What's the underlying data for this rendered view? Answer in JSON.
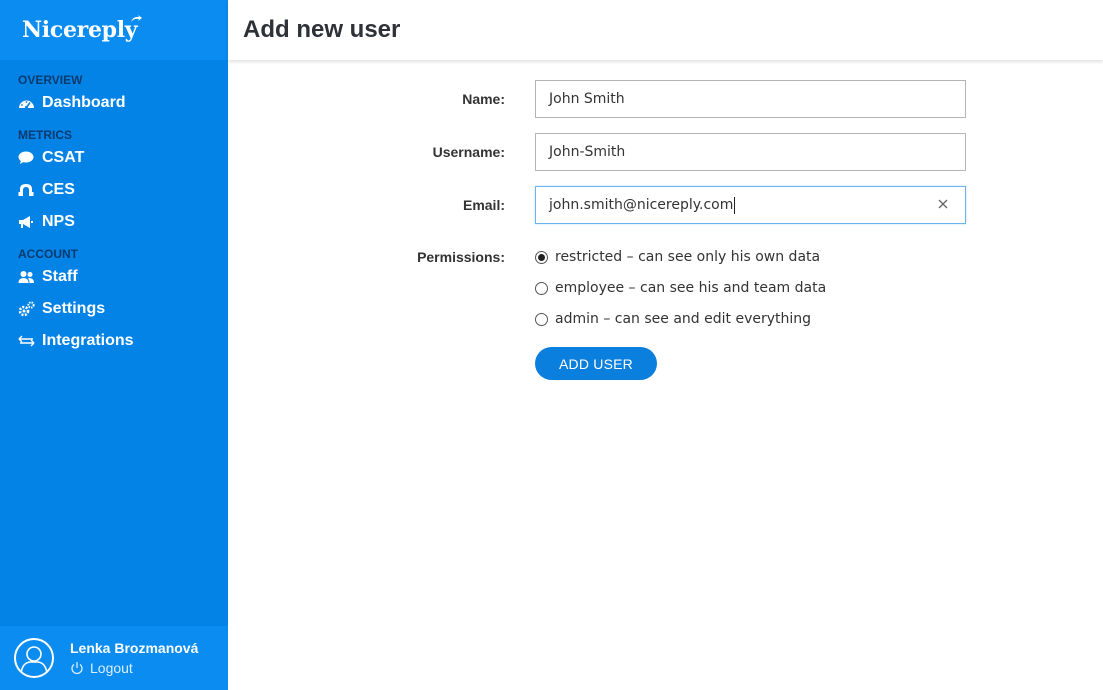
{
  "app": {
    "logo_text": "Nicereply",
    "brand_color": "#0483e7"
  },
  "sidebar": {
    "sections": [
      {
        "label": "OVERVIEW",
        "items": [
          {
            "label": "Dashboard",
            "icon": "dashboard-gauge-icon"
          }
        ]
      },
      {
        "label": "METRICS",
        "items": [
          {
            "label": "CSAT",
            "icon": "speech-bubble-icon"
          },
          {
            "label": "CES",
            "icon": "ces-icon"
          },
          {
            "label": "NPS",
            "icon": "megaphone-icon"
          }
        ]
      },
      {
        "label": "ACCOUNT",
        "items": [
          {
            "label": "Staff",
            "icon": "users-icon"
          },
          {
            "label": "Settings",
            "icon": "gears-icon"
          },
          {
            "label": "Integrations",
            "icon": "arrows-exchange-icon"
          }
        ]
      }
    ],
    "user": {
      "name": "Lenka Brozmanová",
      "logout_label": "Logout"
    }
  },
  "header": {
    "title": "Add new user"
  },
  "form": {
    "name": {
      "label": "Name:",
      "value": "John Smith"
    },
    "username": {
      "label": "Username:",
      "value": "John-Smith"
    },
    "email": {
      "label": "Email:",
      "value": "john.smith@nicereply.com"
    },
    "permissions": {
      "label": "Permissions:",
      "options": [
        {
          "label": "restricted – can see only his own data",
          "selected": true
        },
        {
          "label": "employee – can see his and team data",
          "selected": false
        },
        {
          "label": "admin – can see and edit everything",
          "selected": false
        }
      ]
    },
    "submit_label": "ADD USER"
  }
}
